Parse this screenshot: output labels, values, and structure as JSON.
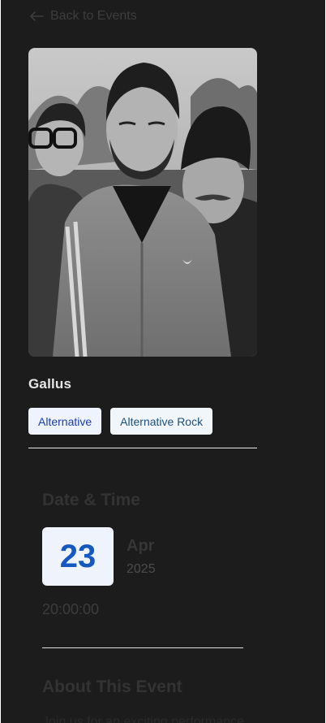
{
  "nav": {
    "back_label": "Back to Events",
    "back_icon": "arrow-left-icon"
  },
  "artist": {
    "name": "Gallus",
    "photo": "band-photo"
  },
  "tags": [
    {
      "label": "Alternative"
    },
    {
      "label": "Alternative Rock"
    }
  ],
  "date_time": {
    "heading": "Date & Time",
    "day": "23",
    "month": "Apr",
    "year": "2025",
    "time": "20:00:00"
  },
  "about": {
    "heading": "About This Event",
    "text": "Join us for an exciting performance"
  },
  "colors": {
    "page_bg": "#1c1c1c",
    "accent_blue": "#1558c0",
    "date_box_bg": "#eff4fc",
    "tag_bg": "#eef3fd"
  }
}
